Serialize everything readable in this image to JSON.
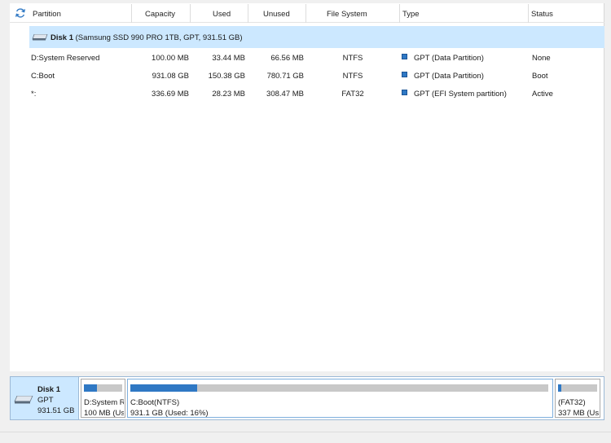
{
  "columns": {
    "partition": "Partition",
    "capacity": "Capacity",
    "used": "Used",
    "unused": "Unused",
    "filesystem": "File System",
    "type": "Type",
    "status": "Status"
  },
  "disk": {
    "name": "Disk 1",
    "details": "(Samsung SSD 990 PRO 1TB, GPT, 931.51 GB)"
  },
  "partitions": [
    {
      "name": "D:System Reserved",
      "capacity": "100.00 MB",
      "used": "33.44 MB",
      "unused": "66.56 MB",
      "fs": "NTFS",
      "type": "GPT (Data Partition)",
      "status": "None"
    },
    {
      "name": "C:Boot",
      "capacity": "931.08 GB",
      "used": "150.38 GB",
      "unused": "780.71 GB",
      "fs": "NTFS",
      "type": "GPT (Data Partition)",
      "status": "Boot"
    },
    {
      "name": "*:",
      "capacity": "336.69 MB",
      "used": "28.23 MB",
      "unused": "308.47 MB",
      "fs": "FAT32",
      "type": "GPT (EFI System partition)",
      "status": "Active"
    }
  ],
  "disk_map": {
    "name": "Disk 1",
    "style": "GPT",
    "size": "931.51 GB",
    "blocks": [
      {
        "label": "D:System Re",
        "detail": "100 MB (Us",
        "used_fraction": 0.33
      },
      {
        "label": "C:Boot(NTFS)",
        "detail": "931.1 GB (Used: 16%)",
        "used_fraction": 0.16
      },
      {
        "label": "(FAT32)",
        "detail": "337 MB (Us",
        "used_fraction": 0.08
      }
    ]
  },
  "colors": {
    "selection": "#cce8ff",
    "partition_type": "#2f78c4",
    "used_bar": "#2f78c4"
  }
}
